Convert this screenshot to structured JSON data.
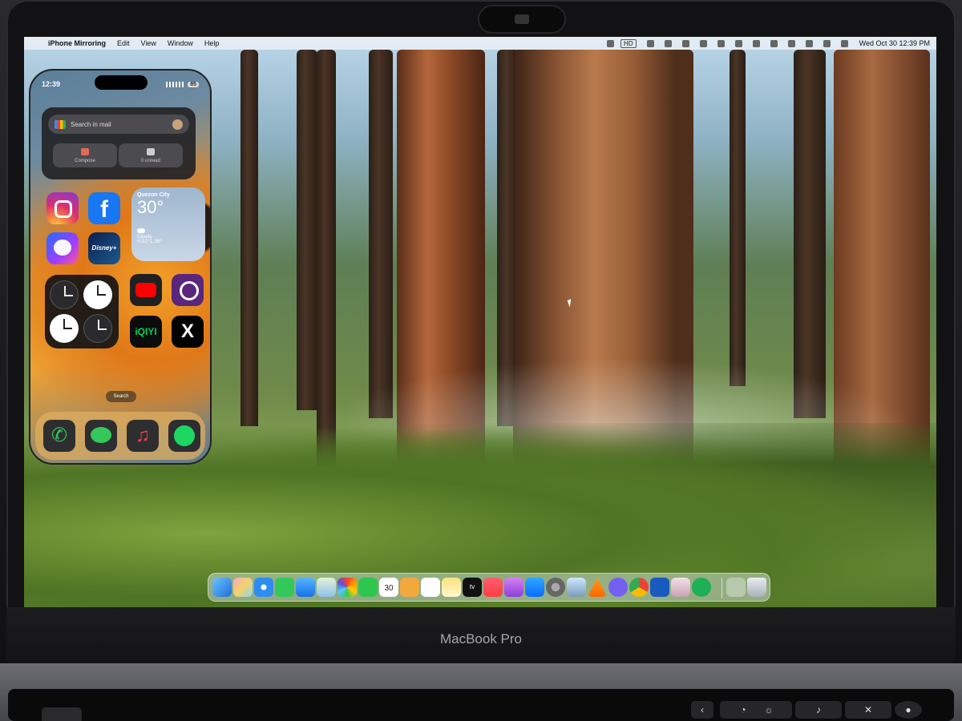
{
  "menubar": {
    "app_name": "iPhone Mirroring",
    "items": [
      "Edit",
      "View",
      "Window",
      "Help"
    ],
    "status_badge": "HD",
    "clock": "Wed Oct 30  12:39 PM"
  },
  "iphone": {
    "time": "12:39",
    "battery": "85",
    "gmail": {
      "search_placeholder": "Search in mail",
      "compose_label": "Compose",
      "unread_label": "0 unread"
    },
    "weather": {
      "city": "Quezon City",
      "temperature": "30°",
      "condition": "Cloudy",
      "high_low": "H:31° L:26°"
    },
    "apps": {
      "disney_label": "Disney+",
      "iqiyi_label": "iQIYI",
      "x_label": "X"
    },
    "search_label": "Search"
  },
  "dock": {
    "calendar_day": "30",
    "calendar_month": "OCT",
    "tv_label": "tv"
  },
  "brand": "MacBook Pro",
  "colors": {
    "menubar_bg": "#ebf0f5",
    "accent_green": "#34c759",
    "youtube_red": "#ff0000",
    "facebook_blue": "#1877f2"
  }
}
